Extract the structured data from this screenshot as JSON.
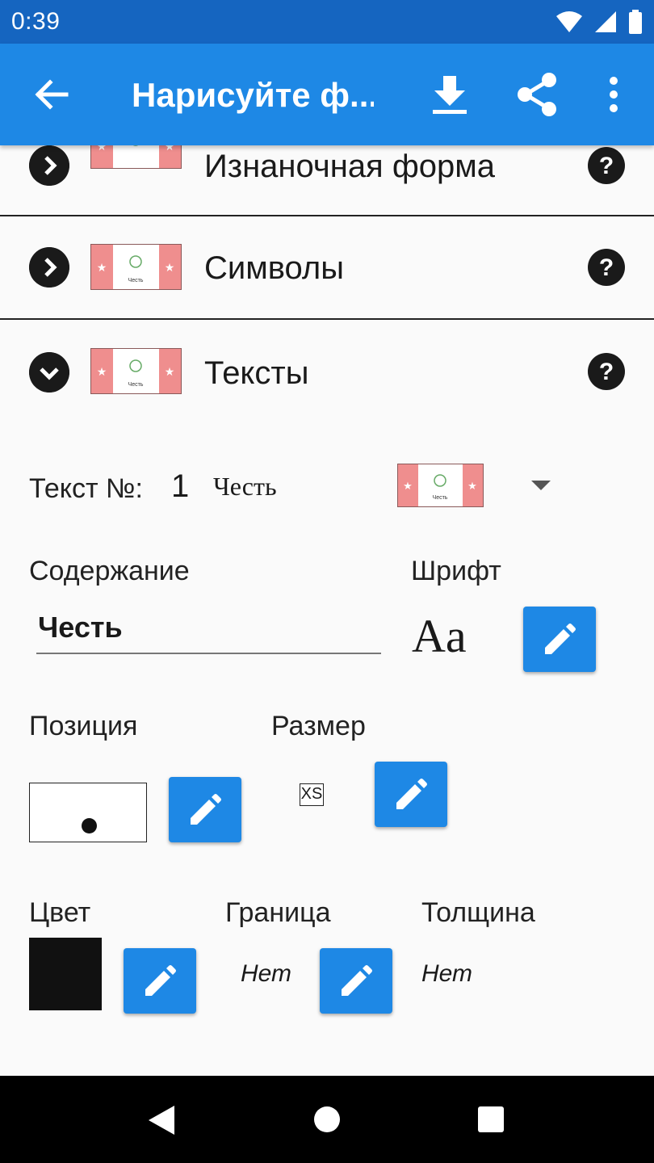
{
  "status_bar": {
    "time": "0:39"
  },
  "app_bar": {
    "title": "Нарисуйте ф..."
  },
  "sections": [
    {
      "title": "Изнаночная форма",
      "expanded": false
    },
    {
      "title": "Символы",
      "expanded": false
    },
    {
      "title": "Тексты",
      "expanded": true
    }
  ],
  "texts_panel": {
    "text_number_label": "Текст №:",
    "text_number": "1",
    "text_name": "Честь",
    "thumb_caption": "Честь",
    "content_label": "Содержание",
    "content_value": "Честь",
    "font_label": "Шрифт",
    "font_preview": "Aa",
    "position_label": "Позиция",
    "size_label": "Размер",
    "size_value": "XS",
    "color_label": "Цвет",
    "color_value": "#111111",
    "border_label": "Граница",
    "border_value": "Нет",
    "thickness_label": "Толщина",
    "thickness_value": "Нет"
  },
  "colors": {
    "status_bar": "#1565c0",
    "app_bar": "#1e88e5",
    "button": "#1e88e5",
    "flag_side": "#ef8e8e"
  }
}
